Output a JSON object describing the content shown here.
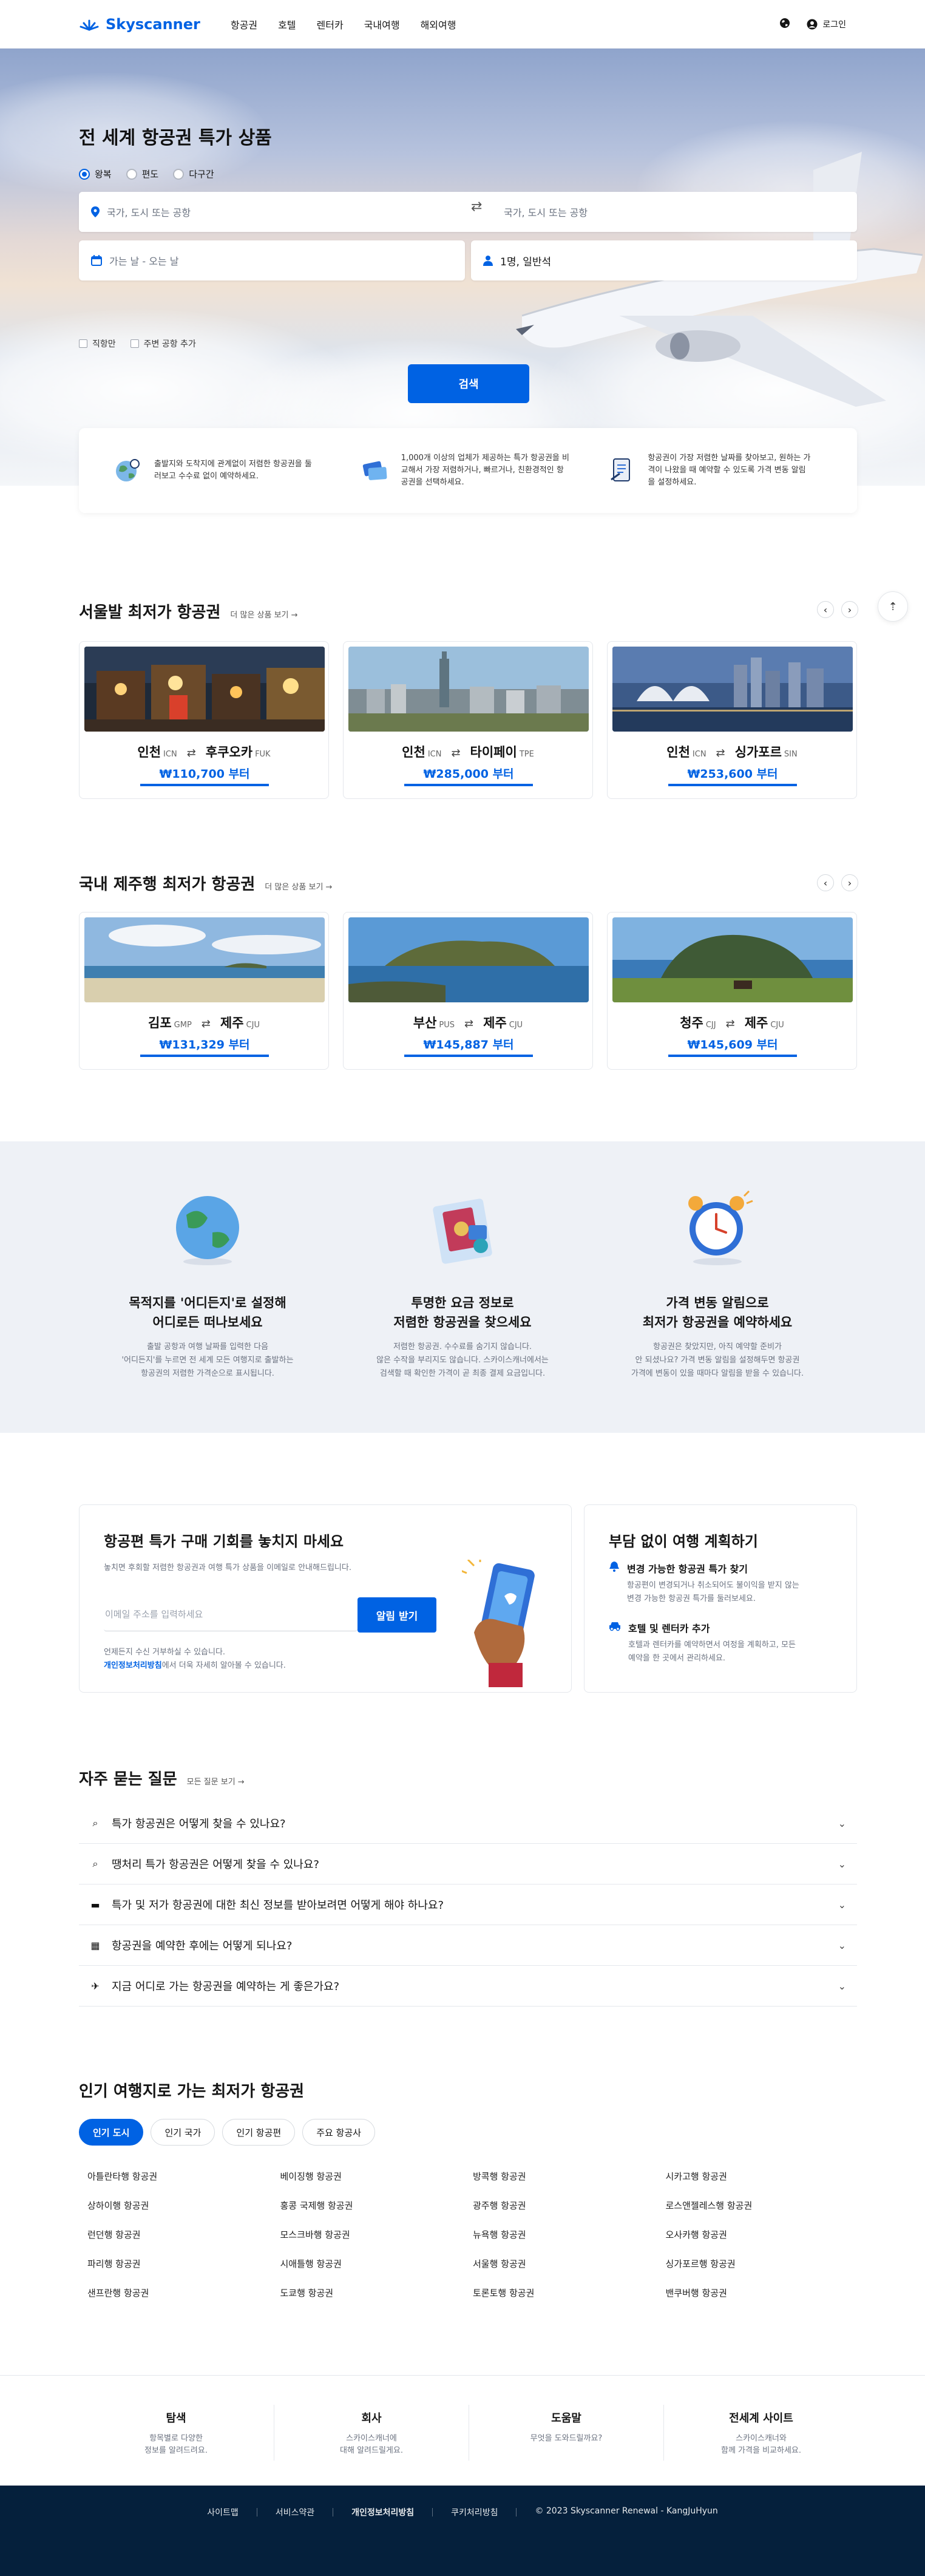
{
  "brand": {
    "name": "Skyscanner",
    "color": "#0062e3"
  },
  "header": {
    "nav": [
      "항공권",
      "호텔",
      "렌터카",
      "국내여행",
      "해외여행"
    ],
    "login": "로그인"
  },
  "hero": {
    "title": "전 세계 항공권 특가 상품",
    "trip_types": [
      "왕복",
      "편도",
      "다구간"
    ],
    "selected_trip_type": "왕복",
    "origin_placeholder": "국가, 도시 또는 공항",
    "destination_placeholder": "국가, 도시 또는 공항",
    "dates_placeholder": "가는 날 - 오는 날",
    "travelers_value": "1명, 일반석",
    "checkboxes": [
      "직항만",
      "주변 공항 추가"
    ],
    "search_label": "검색"
  },
  "features": [
    "출발지와 도착지에 관계없이 저렴한 항공권을 둘러보고 수수료 없이 예약하세요.",
    "1,000개 이상의 업체가 제공하는 특가 항공권을 비교해서 가장 저렴하거나, 빠르거나, 친환경적인 항공권을 선택하세요.",
    "항공권이 가장 저렴한 날짜를 찾아보고, 원하는 가격이 나왔을 때 예약할 수 있도록 가격 변동 알림을 설정하세요."
  ],
  "seoul_section": {
    "title": "서울발 최저가 항공권",
    "more": "더 많은 상품 보기 →",
    "cards": [
      {
        "from": "인천",
        "from_code": "ICN",
        "to": "후쿠오카",
        "to_code": "FUK",
        "price": "₩110,700 부터"
      },
      {
        "from": "인천",
        "from_code": "ICN",
        "to": "타이페이",
        "to_code": "TPE",
        "price": "₩285,000 부터"
      },
      {
        "from": "인천",
        "from_code": "ICN",
        "to": "싱가포르",
        "to_code": "SIN",
        "price": "₩253,600 부터"
      }
    ]
  },
  "jeju_section": {
    "title": "국내 제주행 최저가 항공권",
    "more": "더 많은 상품 보기 →",
    "cards": [
      {
        "from": "김포",
        "from_code": "GMP",
        "to": "제주",
        "to_code": "CJU",
        "price": "₩131,329 부터"
      },
      {
        "from": "부산",
        "from_code": "PUS",
        "to": "제주",
        "to_code": "CJU",
        "price": "₩145,887 부터"
      },
      {
        "from": "청주",
        "from_code": "CJJ",
        "to": "제주",
        "to_code": "CJU",
        "price": "₩145,609 부터"
      }
    ]
  },
  "info": [
    {
      "title1": "목적지를 '어디든지'로 설정해",
      "title2": "어디로든 떠나보세요",
      "desc1": "출발 공항과 여행 날짜를 입력한 다음",
      "desc2": "'어디든지'를 누르면 전 세계 모든 여행지로 출발하는",
      "desc3": "항공권의 저렴한 가격순으로 표시됩니다."
    },
    {
      "title1": "투명한 요금 정보로",
      "title2": "저렴한 항공권을 찾으세요",
      "desc1": "저렴한 항공권. 수수료를 숨기지 않습니다.",
      "desc2": "않은 수작을 부리지도 않습니다. 스카이스캐너에서는",
      "desc3": "검색할 때 확인한 가격이 곧 최종 결제 요금입니다."
    },
    {
      "title1": "가격 변동 알림으로",
      "title2": "최저가 항공권을 예약하세요",
      "desc1": "항공권은 찾았지만, 아직 예약할 준비가",
      "desc2": "안 되셨나요? 가격 변동 알림을 설정해두면 항공권",
      "desc3": "가격에 변동이 있을 때마다 알림을 받을 수 있습니다."
    }
  ],
  "newsletter": {
    "title": "항공편 특가 구매 기회를 놓치지 마세요",
    "subtitle": "놓치면 후회할 저렴한 항공권과 여행 특가 상품을 이메일로 안내해드립니다.",
    "placeholder": "이메일 주소를 입력하세요",
    "button": "알림 받기",
    "note1": "언제든지 수신 거부하실 수 있습니다.",
    "note_link": "개인정보처리방침",
    "note2": "에서 더욱 자세히 알아볼 수 있습니다."
  },
  "plan": {
    "title": "부담 없이 여행 계획하기",
    "items": [
      {
        "title": "변경 가능한 항공권 특가 찾기",
        "desc1": "항공편이 변경되거나 취소되어도 불이익을 받지 않는",
        "desc2": "변경 가능한 항공권 특가를 둘러보세요."
      },
      {
        "title": "호텔 및 렌터카 추가",
        "desc1": "호텔과 렌터카를 예약하면서 여정을 계획하고, 모든",
        "desc2": "예약을 한 곳에서 관리하세요."
      }
    ]
  },
  "faq": {
    "title": "자주 묻는 질문",
    "more": "모든 질문 보기 →",
    "items": [
      {
        "icon": "search-icon",
        "q": "특가 항공권은 어떻게 찾을 수 있나요?"
      },
      {
        "icon": "search-icon",
        "q": "땡처리 특가 항공권은 어떻게 찾을 수 있나요?"
      },
      {
        "icon": "ticket-icon",
        "q": "특가 및 저가 항공권에 대한 최신 정보를 받아보려면 어떻게 해야 하나요?"
      },
      {
        "icon": "calendar-icon",
        "q": "항공권을 예약한 후에는 어떻게 되나요?"
      },
      {
        "icon": "plane-icon",
        "q": "지금 어디로 가는 항공권을 예약하는 게 좋은가요?"
      }
    ]
  },
  "popular": {
    "title": "인기 여행지로 가는 최저가 항공권",
    "tabs": [
      "인기 도시",
      "인기 국가",
      "인기 항공편",
      "주요 항공사"
    ],
    "active_tab": "인기 도시",
    "items": [
      "아틀란타행 항공권",
      "베이징행 항공권",
      "방콕행 항공권",
      "시카고행 항공권",
      "상하이행 항공권",
      "홍콩 국제행 항공권",
      "광주행 항공권",
      "로스앤젤레스행 항공권",
      "런던행 항공권",
      "모스크바행 항공권",
      "뉴욕행 항공권",
      "오사카행 항공권",
      "파리행 항공권",
      "시애틀행 항공권",
      "서울행 항공권",
      "싱가포르행 항공권",
      "샌프란행 항공권",
      "도쿄행 항공권",
      "토론토행 항공권",
      "밴쿠버행 항공권"
    ]
  },
  "footer": {
    "columns": [
      {
        "title": "탐색",
        "desc1": "항목별로 다양한",
        "desc2": "정보를 알려드려요."
      },
      {
        "title": "회사",
        "desc1": "스카이스캐너에",
        "desc2": "대해 알려드릴게요."
      },
      {
        "title": "도움말",
        "desc1": "무엇을 도와드릴까요?",
        "desc2": ""
      },
      {
        "title": "전세계 사이트",
        "desc1": "스카이스캐너와",
        "desc2": "함께 가격을 비교하세요."
      }
    ],
    "links": [
      "사이트맵",
      "서비스약관",
      "개인정보처리방침",
      "쿠키처리방침",
      "© 2023 Skyscanner Renewal - KangJuHyun"
    ]
  }
}
